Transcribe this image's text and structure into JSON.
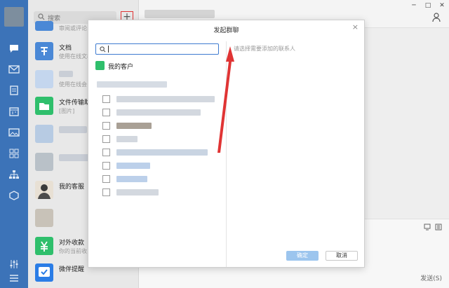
{
  "app": {
    "search_placeholder": "搜索",
    "add_label": "+",
    "send_label": "发送(S)",
    "window": {
      "minimize": "─",
      "maximize": "□",
      "close": "✕"
    }
  },
  "conversations": [
    {
      "title": "",
      "sub": "审阅或评论"
    },
    {
      "title": "文档",
      "sub": "使用在线文档"
    },
    {
      "title": "",
      "sub": "使用在线会"
    },
    {
      "title": "文件传输助",
      "sub": "[图片]"
    },
    {
      "title": "",
      "sub": ""
    },
    {
      "title": "",
      "sub": ""
    },
    {
      "title": "我的客服",
      "sub": ""
    },
    {
      "title": "",
      "sub": ""
    },
    {
      "title": "对外收款",
      "sub": "你的当前收"
    },
    {
      "title": "微伴提醒",
      "sub": ""
    }
  ],
  "dialog": {
    "title": "发起群聊",
    "close": "×",
    "group_label": "我的客户",
    "right_placeholder": "请选择需要添加的联系人",
    "ok_label": "确定",
    "cancel_label": "取消"
  },
  "colors": {
    "rail": "#3c73b8",
    "accent": "#3e7bd0",
    "annotation": "#e03434",
    "wecom_green": "#2fbf6c"
  }
}
